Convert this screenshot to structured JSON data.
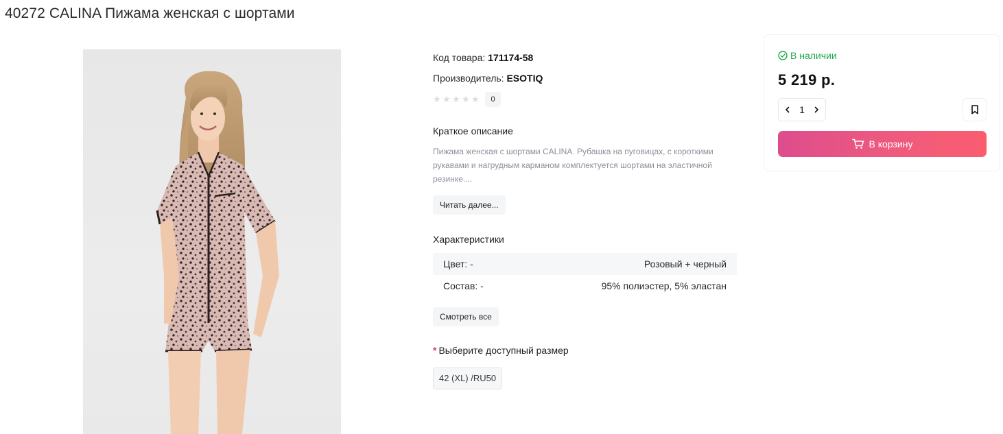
{
  "product": {
    "title": "40272 CALINA Пижама женская с шортами",
    "image_alt": "CALINA Пижама женская с шортами",
    "code_label": "Код товара:",
    "code_value": "171174-58",
    "maker_label": "Производитель:",
    "maker_value": "ESOTIQ",
    "rating": 0,
    "rating_max": 5,
    "reviews_count": "0"
  },
  "description": {
    "title": "Краткое описание",
    "text": "Пижама женская с шортами CALINA. Рубашка на пуговицах, с короткими рукавами и нагрудным карманом комплектуется шортами на эластичной резинке....",
    "read_more_label": "Читать далее..."
  },
  "characteristics": {
    "title": "Характеристики",
    "rows": [
      {
        "label": "Цвет: -",
        "value": "Розовый + черный"
      },
      {
        "label": "Состав: -",
        "value": "95% полиэстер, 5% эластан"
      }
    ],
    "see_all_label": "Смотреть все"
  },
  "size": {
    "required_mark": "*",
    "title": "Выберите доступный размер",
    "options": [
      "42 (XL) /RU50"
    ]
  },
  "buy_box": {
    "stock_label": "В наличии",
    "price": "5 219 р.",
    "quantity": "1",
    "cart_label": "В корзину",
    "icons": {
      "stock": "check-circle-icon",
      "minus": "chevron-left-icon",
      "plus": "chevron-right-icon",
      "bookmark": "bookmark-icon",
      "cart": "cart-icon"
    },
    "colors": {
      "stock": "#1fa84f",
      "cart_gradient_start": "#dd4d8d",
      "cart_gradient_end": "#fb5d6f"
    }
  }
}
